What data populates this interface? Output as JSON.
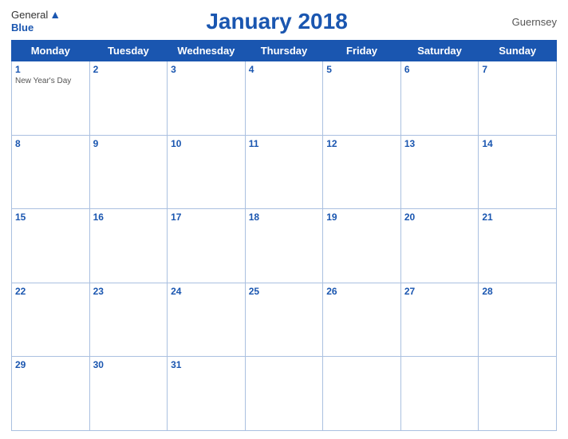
{
  "logo": {
    "general": "General",
    "blue": "Blue",
    "icon_unicode": "▲"
  },
  "title": "January 2018",
  "region": "Guernsey",
  "weekdays": [
    "Monday",
    "Tuesday",
    "Wednesday",
    "Thursday",
    "Friday",
    "Saturday",
    "Sunday"
  ],
  "weeks": [
    [
      {
        "day": "1",
        "event": "New Year's Day"
      },
      {
        "day": "2",
        "event": ""
      },
      {
        "day": "3",
        "event": ""
      },
      {
        "day": "4",
        "event": ""
      },
      {
        "day": "5",
        "event": ""
      },
      {
        "day": "6",
        "event": ""
      },
      {
        "day": "7",
        "event": ""
      }
    ],
    [
      {
        "day": "8",
        "event": ""
      },
      {
        "day": "9",
        "event": ""
      },
      {
        "day": "10",
        "event": ""
      },
      {
        "day": "11",
        "event": ""
      },
      {
        "day": "12",
        "event": ""
      },
      {
        "day": "13",
        "event": ""
      },
      {
        "day": "14",
        "event": ""
      }
    ],
    [
      {
        "day": "15",
        "event": ""
      },
      {
        "day": "16",
        "event": ""
      },
      {
        "day": "17",
        "event": ""
      },
      {
        "day": "18",
        "event": ""
      },
      {
        "day": "19",
        "event": ""
      },
      {
        "day": "20",
        "event": ""
      },
      {
        "day": "21",
        "event": ""
      }
    ],
    [
      {
        "day": "22",
        "event": ""
      },
      {
        "day": "23",
        "event": ""
      },
      {
        "day": "24",
        "event": ""
      },
      {
        "day": "25",
        "event": ""
      },
      {
        "day": "26",
        "event": ""
      },
      {
        "day": "27",
        "event": ""
      },
      {
        "day": "28",
        "event": ""
      }
    ],
    [
      {
        "day": "29",
        "event": ""
      },
      {
        "day": "30",
        "event": ""
      },
      {
        "day": "31",
        "event": ""
      },
      {
        "day": "",
        "event": ""
      },
      {
        "day": "",
        "event": ""
      },
      {
        "day": "",
        "event": ""
      },
      {
        "day": "",
        "event": ""
      }
    ]
  ]
}
